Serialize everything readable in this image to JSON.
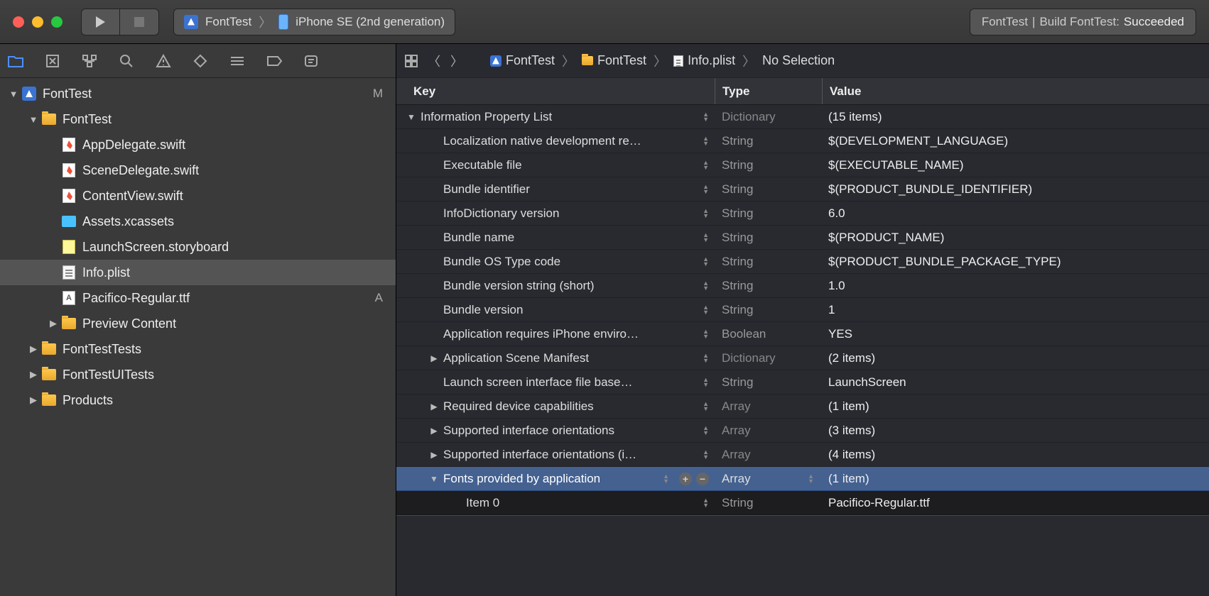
{
  "toolbar": {
    "scheme_target": "FontTest",
    "scheme_device": "iPhone SE (2nd generation)",
    "status_project": "FontTest",
    "status_action": "Build FontTest:",
    "status_result": "Succeeded"
  },
  "navigator": {
    "root": {
      "name": "FontTest",
      "status": "M"
    },
    "tree": [
      {
        "name": "FontTest",
        "icon": "folder",
        "indent": 1,
        "disc": "▼",
        "status": ""
      },
      {
        "name": "AppDelegate.swift",
        "icon": "swift",
        "indent": 2,
        "disc": "",
        "status": ""
      },
      {
        "name": "SceneDelegate.swift",
        "icon": "swift",
        "indent": 2,
        "disc": "",
        "status": ""
      },
      {
        "name": "ContentView.swift",
        "icon": "swift",
        "indent": 2,
        "disc": "",
        "status": ""
      },
      {
        "name": "Assets.xcassets",
        "icon": "xcassets",
        "indent": 2,
        "disc": "",
        "status": ""
      },
      {
        "name": "LaunchScreen.storyboard",
        "icon": "story",
        "indent": 2,
        "disc": "",
        "status": ""
      },
      {
        "name": "Info.plist",
        "icon": "plist",
        "indent": 2,
        "disc": "",
        "status": "",
        "selected": true
      },
      {
        "name": "Pacifico-Regular.ttf",
        "icon": "ttf",
        "indent": 2,
        "disc": "",
        "status": "A"
      },
      {
        "name": "Preview Content",
        "icon": "folder",
        "indent": 2,
        "disc": "▶",
        "status": ""
      },
      {
        "name": "FontTestTests",
        "icon": "folder",
        "indent": 1,
        "disc": "▶",
        "status": ""
      },
      {
        "name": "FontTestUITests",
        "icon": "folder",
        "indent": 1,
        "disc": "▶",
        "status": ""
      },
      {
        "name": "Products",
        "icon": "folder",
        "indent": 1,
        "disc": "▶",
        "status": ""
      }
    ]
  },
  "jumpbar": {
    "items": [
      "FontTest",
      "FontTest",
      "Info.plist",
      "No Selection"
    ]
  },
  "plist": {
    "header": {
      "key": "Key",
      "type": "Type",
      "value": "Value"
    },
    "rows": [
      {
        "key": "Information Property List",
        "type": "Dictionary",
        "value": "(15 items)",
        "indent": 0,
        "disc": "▼",
        "muted": true
      },
      {
        "key": "Localization native development re…",
        "type": "String",
        "value": "$(DEVELOPMENT_LANGUAGE)",
        "indent": 1,
        "disc": ""
      },
      {
        "key": "Executable file",
        "type": "String",
        "value": "$(EXECUTABLE_NAME)",
        "indent": 1,
        "disc": ""
      },
      {
        "key": "Bundle identifier",
        "type": "String",
        "value": "$(PRODUCT_BUNDLE_IDENTIFIER)",
        "indent": 1,
        "disc": ""
      },
      {
        "key": "InfoDictionary version",
        "type": "String",
        "value": "6.0",
        "indent": 1,
        "disc": ""
      },
      {
        "key": "Bundle name",
        "type": "String",
        "value": "$(PRODUCT_NAME)",
        "indent": 1,
        "disc": ""
      },
      {
        "key": "Bundle OS Type code",
        "type": "String",
        "value": "$(PRODUCT_BUNDLE_PACKAGE_TYPE)",
        "indent": 1,
        "disc": ""
      },
      {
        "key": "Bundle version string (short)",
        "type": "String",
        "value": "1.0",
        "indent": 1,
        "disc": ""
      },
      {
        "key": "Bundle version",
        "type": "String",
        "value": "1",
        "indent": 1,
        "disc": ""
      },
      {
        "key": "Application requires iPhone enviro…",
        "type": "Boolean",
        "value": "YES",
        "indent": 1,
        "disc": ""
      },
      {
        "key": "Application Scene Manifest",
        "type": "Dictionary",
        "value": "(2 items)",
        "indent": 1,
        "disc": "▶",
        "muted": true
      },
      {
        "key": "Launch screen interface file base…",
        "type": "String",
        "value": "LaunchScreen",
        "indent": 1,
        "disc": ""
      },
      {
        "key": "Required device capabilities",
        "type": "Array",
        "value": "(1 item)",
        "indent": 1,
        "disc": "▶",
        "muted": true
      },
      {
        "key": "Supported interface orientations",
        "type": "Array",
        "value": "(3 items)",
        "indent": 1,
        "disc": "▶",
        "muted": true
      },
      {
        "key": "Supported interface orientations (i…",
        "type": "Array",
        "value": "(4 items)",
        "indent": 1,
        "disc": "▶",
        "muted": true
      },
      {
        "key": "Fonts provided by application",
        "type": "Array",
        "value": "(1 item)",
        "indent": 1,
        "disc": "▼",
        "muted": true,
        "selected": true,
        "show_add_remove": true,
        "show_type_stepper": true
      },
      {
        "key": "Item 0",
        "type": "String",
        "value": "Pacifico-Regular.ttf",
        "indent": 2,
        "disc": "",
        "child_selected": true
      }
    ]
  }
}
